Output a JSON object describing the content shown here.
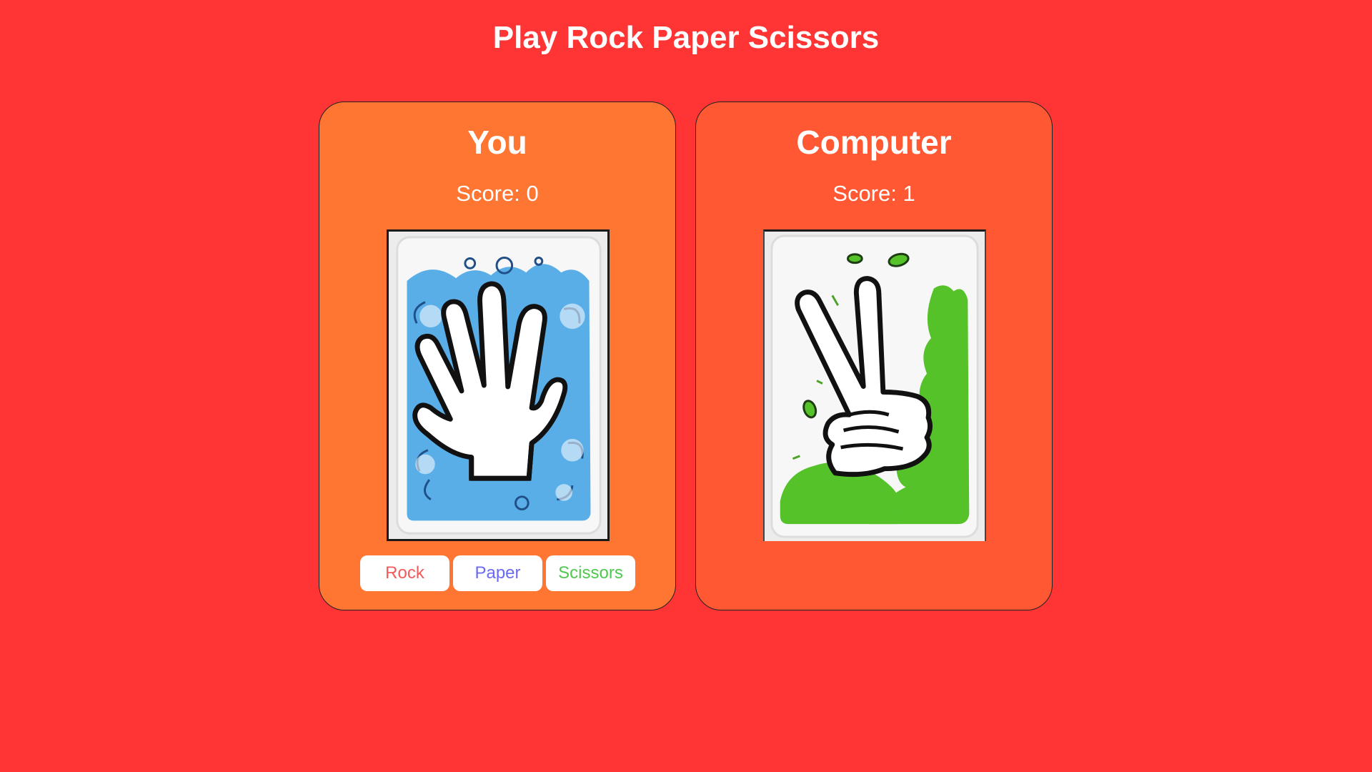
{
  "page": {
    "title": "Play Rock Paper Scissors"
  },
  "player": {
    "name": "You",
    "score_text": "Score: 0",
    "card": "paper-card",
    "card_color": "#5aaee8"
  },
  "computer": {
    "name": "Computer",
    "score_text": "Score: 1",
    "card": "scissors-card",
    "card_color": "#55c22a"
  },
  "choices": {
    "rock_label": "Rock",
    "paper_label": "Paper",
    "scissors_label": "Scissors"
  },
  "colors": {
    "background": "#ff3434",
    "player_panel": "#ff7632",
    "computer_panel": "#ff5833",
    "rock_text": "#f35a5a",
    "paper_text": "#6a6af2",
    "scissors_text": "#4ec94e"
  }
}
